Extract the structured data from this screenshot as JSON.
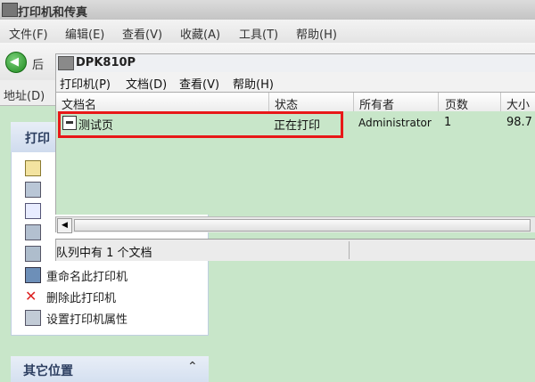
{
  "outer_window": {
    "title": "打印机和传真",
    "menu": [
      "文件(F)",
      "编辑(E)",
      "查看(V)",
      "收藏(A)",
      "工具(T)",
      "帮助(H)"
    ],
    "back_label": "后",
    "address_label": "地址(D)"
  },
  "task_pane": {
    "header": "打印",
    "items": [
      {
        "label": "",
        "icon": "printer-setup-icon"
      },
      {
        "label": "",
        "icon": "printer-icon"
      },
      {
        "label": "",
        "icon": "document-icon"
      },
      {
        "label": "",
        "icon": "share-icon"
      },
      {
        "label": "",
        "icon": "pause-printer-icon"
      },
      {
        "label": "重命名此打印机",
        "icon": "rename-icon"
      },
      {
        "label": "删除此打印机",
        "icon": "delete-icon"
      },
      {
        "label": "设置打印机属性",
        "icon": "properties-icon"
      }
    ],
    "other_header": "其它位置",
    "collapse_glyph": "⌃"
  },
  "queue_window": {
    "title": "DPK810P",
    "menu": [
      "打印机(P)",
      "文档(D)",
      "查看(V)",
      "帮助(H)"
    ],
    "columns": [
      "文档名",
      "状态",
      "所有者",
      "页数",
      "大小"
    ],
    "rows": [
      {
        "name": "测试页",
        "status": "正在打印",
        "owner": "Administrator",
        "pages": "1",
        "size": "98.7"
      }
    ],
    "status_text": "队列中有 1 个文档"
  },
  "colors": {
    "background": "#c8e6c9",
    "highlight": "#e81818"
  }
}
